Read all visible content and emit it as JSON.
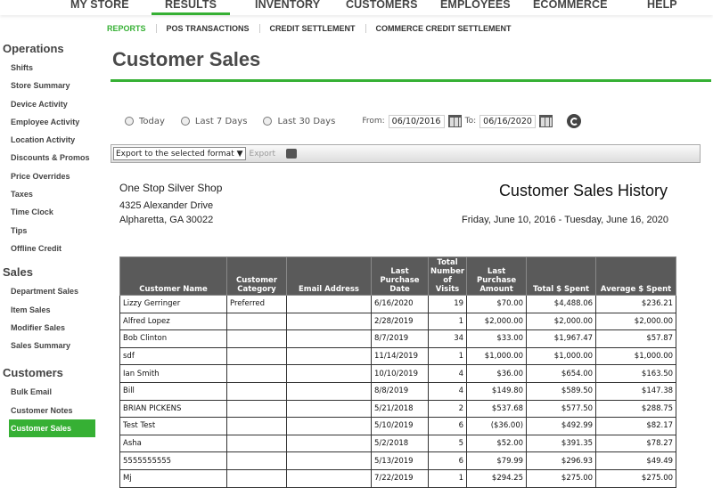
{
  "topnav": [
    "MY STORE",
    "RESULTS",
    "INVENTORY",
    "CUSTOMERS",
    "EMPLOYEES",
    "ECOMMERCE",
    "HELP"
  ],
  "subnav": [
    "REPORTS",
    "POS TRANSACTIONS",
    "CREDIT SETTLEMENT",
    "COMMERCE CREDIT SETTLEMENT"
  ],
  "sidebar": {
    "operations": {
      "title": "Operations",
      "items": [
        "Shifts",
        "Store Summary",
        "Device Activity",
        "Employee Activity",
        "Location Activity",
        "Discounts & Promos",
        "Price Overrides",
        "Taxes",
        "Time Clock",
        "Tips",
        "Offline Credit"
      ]
    },
    "sales": {
      "title": "Sales",
      "items": [
        "Department Sales",
        "Item Sales",
        "Modifier Sales",
        "Sales Summary"
      ]
    },
    "customers": {
      "title": "Customers",
      "items": [
        "Bulk Email",
        "Customer Notes",
        "Customer Sales"
      ]
    }
  },
  "page_title": "Customer Sales",
  "filters": {
    "today": "Today",
    "last7": "Last 7 Days",
    "last30": "Last 30 Days",
    "from_label": "From:",
    "from_value": "06/10/2016",
    "to_label": "To:",
    "to_value": "06/16/2020"
  },
  "toolbar": {
    "export_select": "Export to the selected format",
    "export_label": "Export"
  },
  "report": {
    "shop": "One Stop Silver Shop",
    "addr1": "4325 Alexander Drive",
    "addr2": "Alpharetta, GA 30022",
    "title": "Customer Sales History",
    "range": "Friday, June 10, 2016 - Tuesday, June 16, 2020"
  },
  "table": {
    "headers": [
      "Customer Name",
      "Customer Category",
      "Email Address",
      "Last Purchase Date",
      "Total Number of Visits",
      "Last Purchase Amount",
      "Total $ Spent",
      "Average $ Spent"
    ],
    "rows": [
      [
        "Lizzy Gerringer",
        "Preferred",
        "",
        "6/16/2020",
        "19",
        "$70.00",
        "$4,488.06",
        "$236.21"
      ],
      [
        "Alfred Lopez",
        "",
        "",
        "2/28/2019",
        "1",
        "$2,000.00",
        "$2,000.00",
        "$2,000.00"
      ],
      [
        "Bob Clinton",
        "",
        "",
        "8/7/2019",
        "34",
        "$33.00",
        "$1,967.47",
        "$57.87"
      ],
      [
        "sdf",
        "",
        "",
        "11/14/2019",
        "1",
        "$1,000.00",
        "$1,000.00",
        "$1,000.00"
      ],
      [
        "Ian Smith",
        "",
        "",
        "10/10/2019",
        "4",
        "$36.00",
        "$654.00",
        "$163.50"
      ],
      [
        "Bill",
        "",
        "",
        "8/8/2019",
        "4",
        "$149.80",
        "$589.50",
        "$147.38"
      ],
      [
        "BRIAN PICKENS",
        "",
        "",
        "5/21/2018",
        "2",
        "$537.68",
        "$577.50",
        "$288.75"
      ],
      [
        "Test Test",
        "",
        "",
        "5/10/2019",
        "6",
        "($36.00)",
        "$492.99",
        "$82.17"
      ],
      [
        "Asha",
        "",
        "",
        "5/2/2018",
        "5",
        "$52.00",
        "$391.35",
        "$78.27"
      ],
      [
        "5555555555",
        "",
        "",
        "5/13/2019",
        "6",
        "$79.99",
        "$296.93",
        "$49.49"
      ],
      [
        "Mj",
        "",
        "",
        "7/22/2019",
        "1",
        "$294.25",
        "$275.00",
        "$275.00"
      ]
    ]
  }
}
